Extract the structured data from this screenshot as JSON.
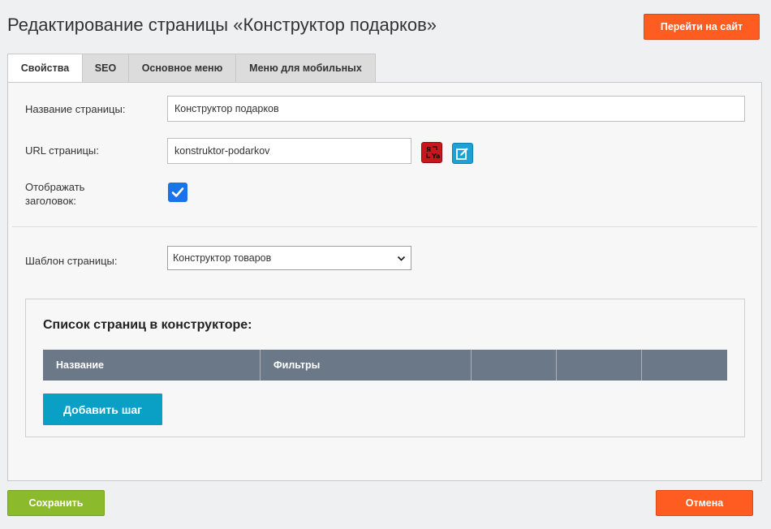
{
  "header": {
    "title": "Редактирование страницы «Конструктор подарков»",
    "site_button": "Перейти на сайт"
  },
  "tabs": [
    {
      "label": "Свойства",
      "active": true
    },
    {
      "label": "SEO",
      "active": false
    },
    {
      "label": "Основное меню",
      "active": false
    },
    {
      "label": "Меню для мобильных",
      "active": false
    }
  ],
  "form": {
    "page_name_label": "Название страницы:",
    "page_name_value": "Конструктор подарков",
    "url_label": "URL страницы:",
    "url_value": "konstruktor-podarkov",
    "show_title_label_line1": "Отображать",
    "show_title_label_line2": "заголовок:",
    "show_title_checked": true,
    "template_label": "Шаблон страницы:",
    "template_value": "Конструктор товаров"
  },
  "constructor": {
    "title": "Список страниц в конструкторе:",
    "columns": [
      "Название",
      "Фильтры",
      "",
      "",
      ""
    ],
    "add_button": "Добавить шаг"
  },
  "footer": {
    "save_button": "Сохранить",
    "cancel_button": "Отмена"
  },
  "colors": {
    "orange": "#ff5c21",
    "green": "#8bbb2c",
    "teal": "#0aa0c6",
    "table_header": "#6a7888",
    "checkbox": "#1a73e8"
  },
  "icons": {
    "translit": "translit-icon",
    "edit": "edit-icon",
    "check": "checkmark-icon",
    "select": "chevron-down-icon"
  }
}
